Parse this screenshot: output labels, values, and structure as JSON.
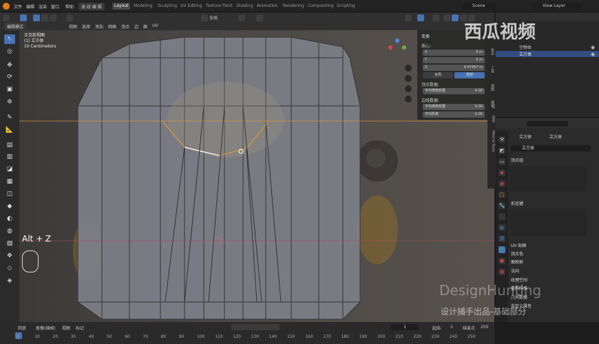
{
  "topmenu": [
    "文件",
    "编辑",
    "渲染",
    "窗口",
    "帮助"
  ],
  "edit_mode_label": "波 纹 编 辑",
  "workspaces": [
    "Layout",
    "Modeling",
    "Sculpting",
    "UV Editing",
    "Texture Paint",
    "Shading",
    "Animation",
    "Rendering",
    "Compositing",
    "Scripting"
  ],
  "scene": "Scene",
  "view_layer": "View Layer",
  "header": {
    "mode": "编辑模式",
    "menus": [
      "视图",
      "选择",
      "添加",
      "网格",
      "顶点",
      "边",
      "面",
      "UV"
    ],
    "transform": "全局"
  },
  "viewport": {
    "view_name": "正交前视图",
    "object": "(1) 立方体",
    "scale": "10 Centimeters",
    "shortcut": "Alt + Z"
  },
  "npanel": {
    "title": "变换",
    "median": "质心:",
    "x_label": "X",
    "x_val": "0 m",
    "y_label": "Y",
    "y_val": "0 m",
    "z_label": "Z",
    "z_val": "0.47457 m",
    "global": "全局",
    "local": "局部",
    "vertex_data": "顶点数据:",
    "v_crease": "平均倒角权重",
    "v_crease_val": "0.00",
    "edge_data": "边线数据:",
    "e_bevel": "平均倒角权重",
    "e_bevel_val": "0.00",
    "e_crease": "平均折痕",
    "e_crease_val": "0.00"
  },
  "ntabs": [
    "条目",
    "工具",
    "视图",
    "编辑",
    "L5",
    "RAR",
    "Mexrio Tools"
  ],
  "outliner": {
    "items": [
      "空物体",
      "立方体"
    ]
  },
  "props": {
    "obj": "立方体",
    "mesh": "立方体",
    "data_name": "立方体",
    "vgroups": "顶点组",
    "shapekeys": "形态键",
    "sections": [
      "UV 贴图",
      "顶点色",
      "面映射",
      "法向",
      "纹理空间",
      "重构网格",
      "几何数据",
      "自定义属性"
    ]
  },
  "timeline": {
    "menus": [
      "回放",
      "抠像(插帧)",
      "视图",
      "标记"
    ],
    "frame": "1",
    "start_label": "起始",
    "start": "1",
    "end_label": "结束点",
    "end": "250",
    "ticks": [
      "0",
      "10",
      "20",
      "30",
      "40",
      "50",
      "60",
      "70",
      "80",
      "90",
      "100",
      "110",
      "120",
      "130",
      "140",
      "150",
      "160",
      "170",
      "180",
      "190",
      "200",
      "210",
      "220",
      "230",
      "240",
      "250"
    ]
  },
  "watermark": {
    "logo": "西瓜视频",
    "brand": "DesignHunting",
    "sub": "设计捕手出品-基础部分"
  }
}
